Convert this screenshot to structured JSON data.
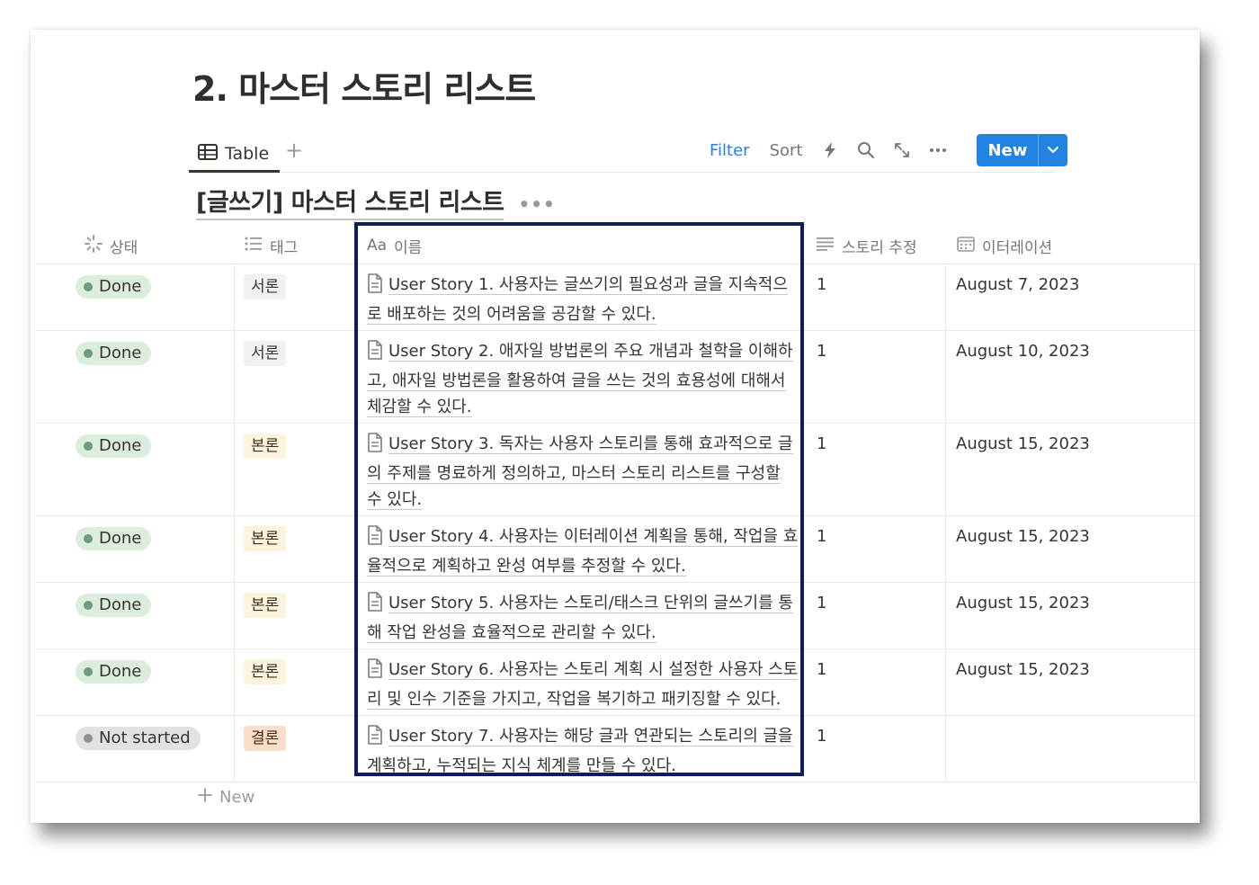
{
  "page": {
    "title": "2. 마스터 스토리 리스트"
  },
  "view": {
    "tab_label": "Table",
    "add_view_label": "+"
  },
  "toolbar": {
    "filter_label": "Filter",
    "sort_label": "Sort",
    "new_label": "New"
  },
  "database": {
    "title": "[글쓰기] 마스터 스토리 리스트",
    "more_label": "•••"
  },
  "columns": {
    "status": "상태",
    "tag": "태그",
    "name_prefix": "Aa",
    "name": "이름",
    "estimate": "스토리 추정",
    "iteration": "이터레이션"
  },
  "colors": {
    "done_bg": "#dbeddb",
    "done_dot": "#6c9b7d",
    "notstarted_bg": "#e3e2e0",
    "notstarted_dot": "#91918e",
    "tag_gray_bg": "#f1f1ef",
    "tag_yellow_bg": "#fbf3db",
    "tag_orange_bg": "#fadec9",
    "accent": "#2383e2",
    "highlight_border": "#0d1e5c"
  },
  "rows": [
    {
      "status": "Done",
      "tag": "서론",
      "story": "User Story 1.",
      "desc": " 사용자는 글쓰기의 필요성과 글을 지속적으로 배포하는 것의 어려움을 공감할 수 있다.",
      "estimate": "1",
      "iteration": "August 7, 2023"
    },
    {
      "status": "Done",
      "tag": "서론",
      "story": "User Story 2.",
      "desc": " 애자일 방법론의 주요 개념과 철학을 이해하고, 애자일 방법론을 활용하여 글을 쓰는 것의 효용성에 대해서 체감할 수 있다.",
      "estimate": "1",
      "iteration": "August 10, 2023"
    },
    {
      "status": "Done",
      "tag": "본론",
      "story": "User Story 3.",
      "desc": " 독자는 사용자 스토리를 통해 효과적으로 글의 주제를 명료하게 정의하고, 마스터 스토리 리스트를 구성할 수 있다.",
      "estimate": "1",
      "iteration": "August 15, 2023"
    },
    {
      "status": "Done",
      "tag": "본론",
      "story": "User Story 4.",
      "desc": " 사용자는 이터레이션 계획을 통해, 작업을 효율적으로 계획하고 완성 여부를 추정할 수 있다.",
      "estimate": "1",
      "iteration": "August 15, 2023"
    },
    {
      "status": "Done",
      "tag": "본론",
      "story": "User Story 5.",
      "desc": " 사용자는 스토리/태스크 단위의 글쓰기를 통해 작업 완성을 효율적으로 관리할 수 있다.",
      "estimate": "1",
      "iteration": "August 15, 2023"
    },
    {
      "status": "Done",
      "tag": "본론",
      "story": "User Story 6.",
      "desc": " 사용자는 스토리 계획 시 설정한 사용자 스토리 및 인수 기준을 가지고, 작업을 복기하고 패키징할 수 있다.",
      "estimate": "1",
      "iteration": "August 15, 2023"
    },
    {
      "status": "Not started",
      "tag": "결론",
      "story": "User Story 7.",
      "desc": " 사용자는 해당 글과 연관되는 스토리의 글을 계획하고, 누적되는 지식 체계를 만들 수 있다.",
      "estimate": "1",
      "iteration": ""
    }
  ],
  "add_row_label": "New"
}
